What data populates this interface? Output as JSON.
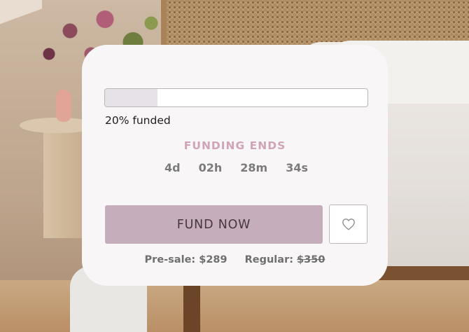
{
  "funding": {
    "progress_fraction": 0.2,
    "funded_label": "20% funded",
    "ends_title": "FUNDING ENDS",
    "countdown": {
      "days": "4d",
      "hours": "02h",
      "minutes": "28m",
      "seconds": "34s"
    }
  },
  "actions": {
    "fund_label": "FUND NOW",
    "wishlist_icon": "heart-icon"
  },
  "pricing": {
    "presale_label": "Pre-sale: $289",
    "regular_label": "Regular:",
    "regular_value": "$350"
  },
  "colors": {
    "accent": "#c6adbb",
    "ends_title": "#cfa4b8",
    "card_background": "#f8f6f6"
  }
}
